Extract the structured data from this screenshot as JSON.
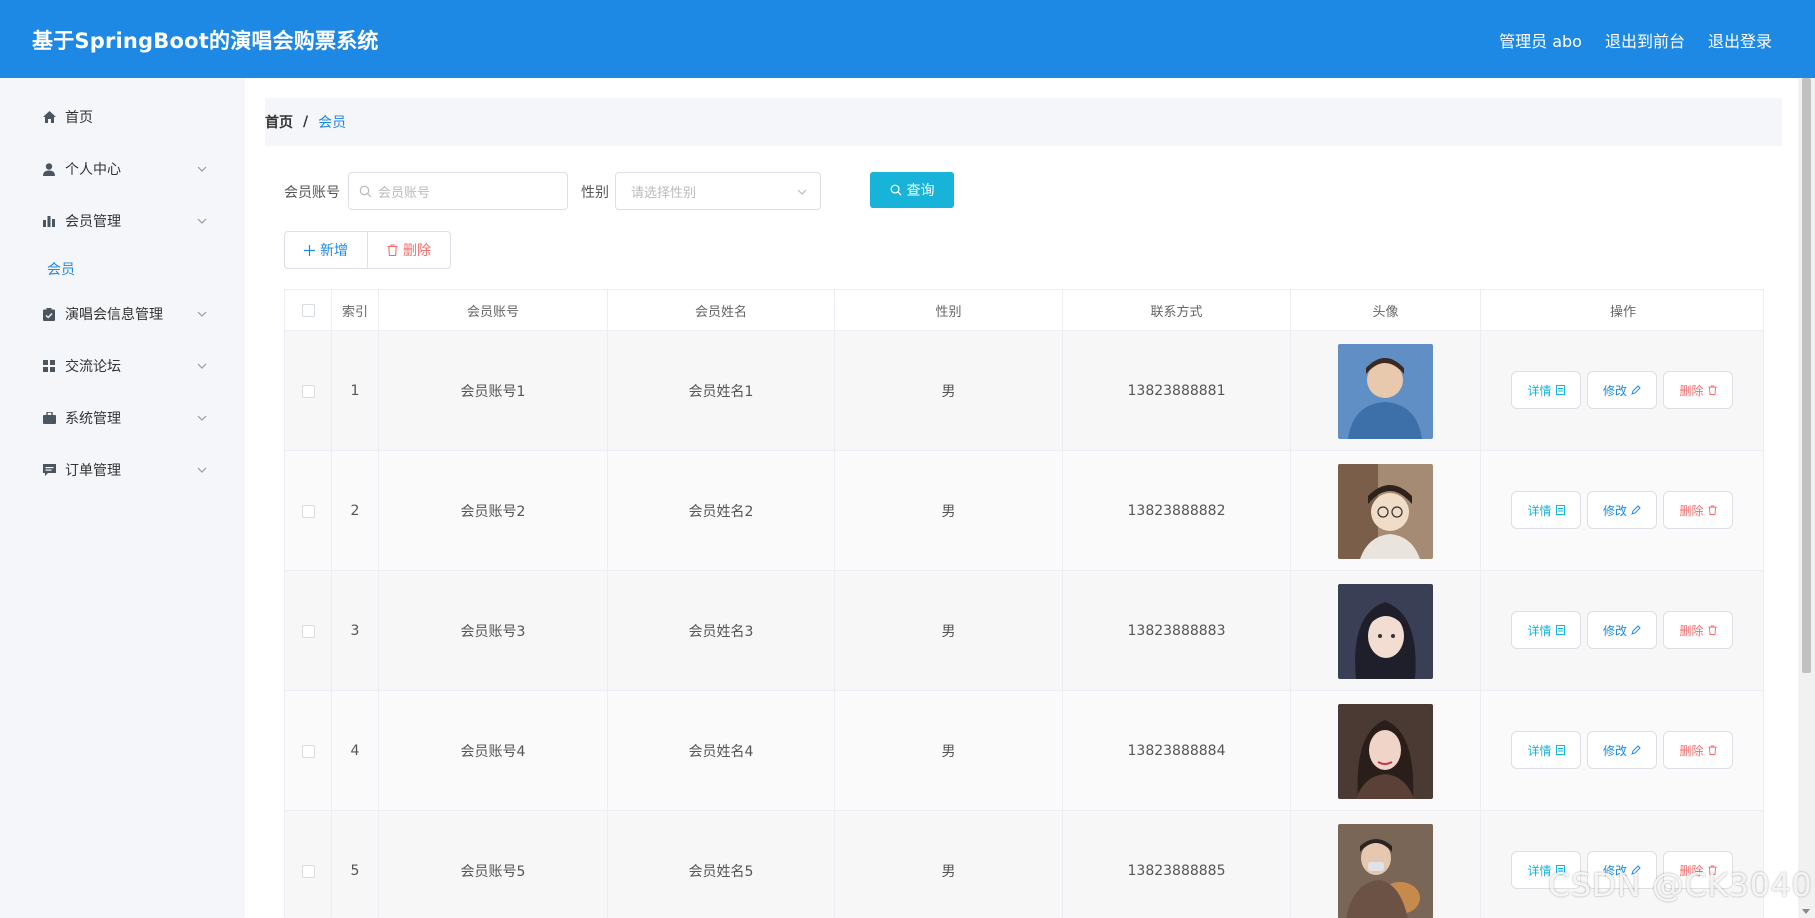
{
  "header": {
    "title": "基于SpringBoot的演唱会购票系统",
    "links": [
      "管理员 abo",
      "退出到前台",
      "退出登录"
    ]
  },
  "sidebar": {
    "items": [
      {
        "label": "首页",
        "icon": "home-icon",
        "has_arrow": false
      },
      {
        "label": "个人中心",
        "icon": "user-icon",
        "has_arrow": true
      },
      {
        "label": "会员管理",
        "icon": "bar-chart-icon",
        "has_arrow": true
      },
      {
        "label": "演唱会信息管理",
        "icon": "clipboard-icon",
        "has_arrow": true
      },
      {
        "label": "交流论坛",
        "icon": "grid-icon",
        "has_arrow": true
      },
      {
        "label": "系统管理",
        "icon": "briefcase-icon",
        "has_arrow": true
      },
      {
        "label": "订单管理",
        "icon": "chat-icon",
        "has_arrow": true
      }
    ],
    "submenu_active": "会员"
  },
  "breadcrumb": {
    "home": "首页",
    "separator": "/",
    "current": "会员"
  },
  "search": {
    "account_label": "会员账号",
    "account_placeholder": "会员账号",
    "gender_label": "性别",
    "gender_placeholder": "请选择性别",
    "search_button": "查询"
  },
  "toolbar": {
    "add_label": "新增",
    "delete_label": "删除"
  },
  "table": {
    "columns": [
      "索引",
      "会员账号",
      "会员姓名",
      "性别",
      "联系方式",
      "头像",
      "操作"
    ],
    "rows": [
      {
        "index": "1",
        "account": "会员账号1",
        "name": "会员姓名1",
        "gender": "男",
        "phone": "13823888881"
      },
      {
        "index": "2",
        "account": "会员账号2",
        "name": "会员姓名2",
        "gender": "男",
        "phone": "13823888882"
      },
      {
        "index": "3",
        "account": "会员账号3",
        "name": "会员姓名3",
        "gender": "男",
        "phone": "13823888883"
      },
      {
        "index": "4",
        "account": "会员账号4",
        "name": "会员姓名4",
        "gender": "男",
        "phone": "13823888884"
      },
      {
        "index": "5",
        "account": "会员账号5",
        "name": "会员姓名5",
        "gender": "男",
        "phone": "13823888885"
      }
    ],
    "actions": {
      "detail": "详情",
      "edit": "修改",
      "delete": "删除"
    }
  },
  "colors": {
    "primary": "#1e88e5",
    "search_button": "#17b3d9",
    "danger": "#f56c6c",
    "detail": "#17b3d9"
  },
  "watermark": "CSDN @CK3040"
}
